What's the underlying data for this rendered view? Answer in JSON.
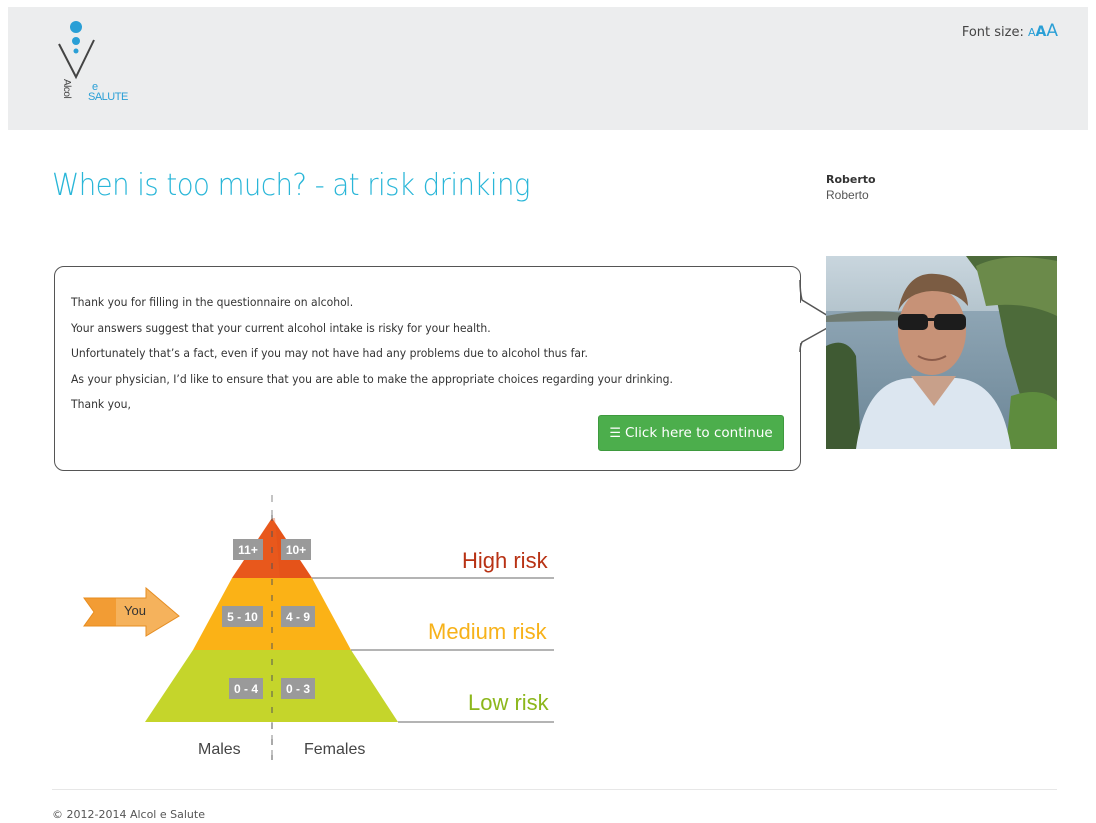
{
  "header": {
    "logo": {
      "letters_e": "e",
      "letters_salute": "SALUTE",
      "letters_alcol": "Alcol"
    },
    "font_size": {
      "label": "Font size:",
      "small": "A",
      "medium": "A",
      "large": "A"
    }
  },
  "main": {
    "title": "When is too much? - at risk drinking",
    "doctor": {
      "name": "Roberto",
      "subtitle": "Roberto"
    },
    "message": {
      "lines": [
        "Thank you for filling in the questionnaire on alcohol.",
        "Your answers suggest that your current alcohol intake is risky for your health.",
        "Unfortunately that’s a fact, even if you may not have had any problems due to alcohol thus far.",
        "As your physician, I’d like to ensure that you are able to make the appropriate choices regarding your drinking.",
        "Thank you,"
      ],
      "continue_button": "Click here to continue",
      "continue_icon": "list-icon"
    }
  },
  "pyramid": {
    "levels": [
      {
        "label": "High risk",
        "males": "11+",
        "females": "10+",
        "color": "#e8581c"
      },
      {
        "label": "Medium risk",
        "males": "5 - 10",
        "females": "4 - 9",
        "color": "#fbb216"
      },
      {
        "label": "Low risk",
        "males": "0 - 4",
        "females": "0 - 3",
        "color": "#c5d52b"
      }
    ],
    "label_colors": {
      "high": "#b83214",
      "medium": "#f7b21a",
      "low": "#8cb71c"
    },
    "males_label": "Males",
    "females_label": "Females",
    "you_label": "You",
    "you_level": "Medium risk"
  },
  "footer": {
    "copyright": "© 2012-2014 Alcol e Salute"
  }
}
